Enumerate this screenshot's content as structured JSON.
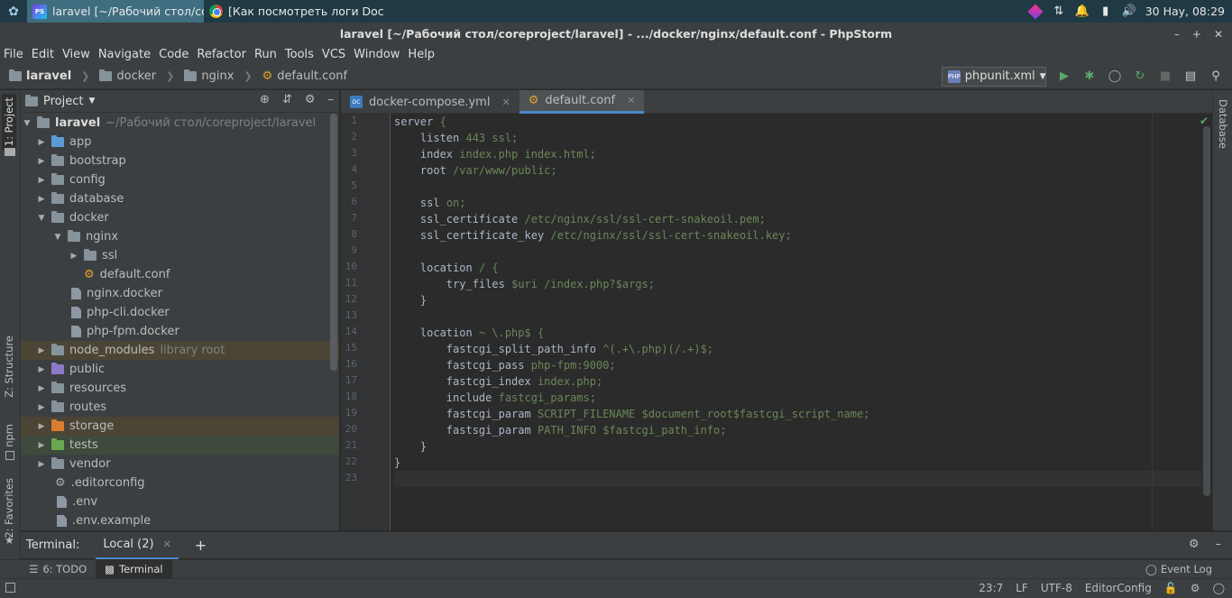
{
  "taskbar": {
    "tasks": [
      {
        "label": "laravel [~/Рабочий стол/cor..."
      },
      {
        "label": "[Как посмотреть логи Dock..."
      }
    ],
    "clock": "30 Нау, 08:29"
  },
  "window": {
    "title": "laravel [~/Рабочий стол/coreproject/laravel] - .../docker/nginx/default.conf - PhpStorm"
  },
  "menu": [
    "File",
    "Edit",
    "View",
    "Navigate",
    "Code",
    "Refactor",
    "Run",
    "Tools",
    "VCS",
    "Window",
    "Help"
  ],
  "breadcrumb": [
    "laravel",
    "docker",
    "nginx",
    "default.conf"
  ],
  "run_config": "phpunit.xml",
  "left_tabs": [
    "1: Project",
    "Z: Structure",
    "npm",
    "2: Favorites"
  ],
  "right_tabs": [
    "Database"
  ],
  "project": {
    "header": "Project",
    "root_name": "laravel",
    "root_path": "~/Рабочий стол/coreproject/laravel",
    "items": [
      {
        "label": "app"
      },
      {
        "label": "bootstrap"
      },
      {
        "label": "config"
      },
      {
        "label": "database"
      },
      {
        "label": "docker"
      },
      {
        "label": "nginx"
      },
      {
        "label": "ssl"
      },
      {
        "label": "default.conf"
      },
      {
        "label": "nginx.docker"
      },
      {
        "label": "php-cli.docker"
      },
      {
        "label": "php-fpm.docker"
      },
      {
        "label": "node_modules",
        "note": "library root"
      },
      {
        "label": "public"
      },
      {
        "label": "resources"
      },
      {
        "label": "routes"
      },
      {
        "label": "storage"
      },
      {
        "label": "tests"
      },
      {
        "label": "vendor"
      },
      {
        "label": ".editorconfig"
      },
      {
        "label": ".env"
      },
      {
        "label": ".env.example"
      }
    ]
  },
  "editor": {
    "tabs": [
      "docker-compose.yml",
      "default.conf"
    ],
    "line_numbers": [
      "1",
      "2",
      "3",
      "4",
      "5",
      "6",
      "7",
      "8",
      "9",
      "10",
      "11",
      "12",
      "13",
      "14",
      "15",
      "16",
      "17",
      "18",
      "19",
      "20",
      "21",
      "22",
      "23"
    ],
    "lines": [
      {
        "k": "server",
        "v": "{"
      },
      {
        "k": "    listen",
        "v": "443 ssl;"
      },
      {
        "k": "    index",
        "v": "index.php index.html;"
      },
      {
        "k": "    root",
        "v": "/var/www/public;"
      },
      {
        "k": "",
        "v": ""
      },
      {
        "k": "    ssl",
        "v": "on;"
      },
      {
        "k": "    ssl_certificate",
        "v": "/etc/nginx/ssl/ssl-cert-snakeoil.pem;"
      },
      {
        "k": "    ssl_certificate_key",
        "v": "/etc/nginx/ssl/ssl-cert-snakeoil.key;"
      },
      {
        "k": "",
        "v": ""
      },
      {
        "k": "    location",
        "v": "/ {"
      },
      {
        "k": "        try_files",
        "v": "$uri /index.php?$args;"
      },
      {
        "k": "    }",
        "v": ""
      },
      {
        "k": "",
        "v": ""
      },
      {
        "k": "    location",
        "v": "~ \\.php$ {"
      },
      {
        "k": "        fastcgi_split_path_info",
        "v": "^(.+\\.php)(/.+)$;"
      },
      {
        "k": "        fastcgi_pass",
        "v": "php-fpm:9000;"
      },
      {
        "k": "        fastcgi_index",
        "v": "index.php;"
      },
      {
        "k": "        include",
        "v": "fastcgi_params;"
      },
      {
        "k": "        fastcgi_param",
        "v": "SCRIPT_FILENAME $document_root$fastcgi_script_name;"
      },
      {
        "k": "        fastsgi_param",
        "v": "PATH_INFO $fastcgi_path_info;"
      },
      {
        "k": "    }",
        "v": ""
      },
      {
        "k": "}",
        "v": ""
      },
      {
        "k": "",
        "v": ""
      }
    ]
  },
  "terminal": {
    "label": "Terminal:",
    "tab": "Local (2)"
  },
  "tool_windows": {
    "todo": "6: TODO",
    "terminal": "Terminal",
    "event_log": "Event Log"
  },
  "status": {
    "position": "23:7",
    "line_sep": "LF",
    "encoding": "UTF-8",
    "config": "EditorConfig"
  }
}
